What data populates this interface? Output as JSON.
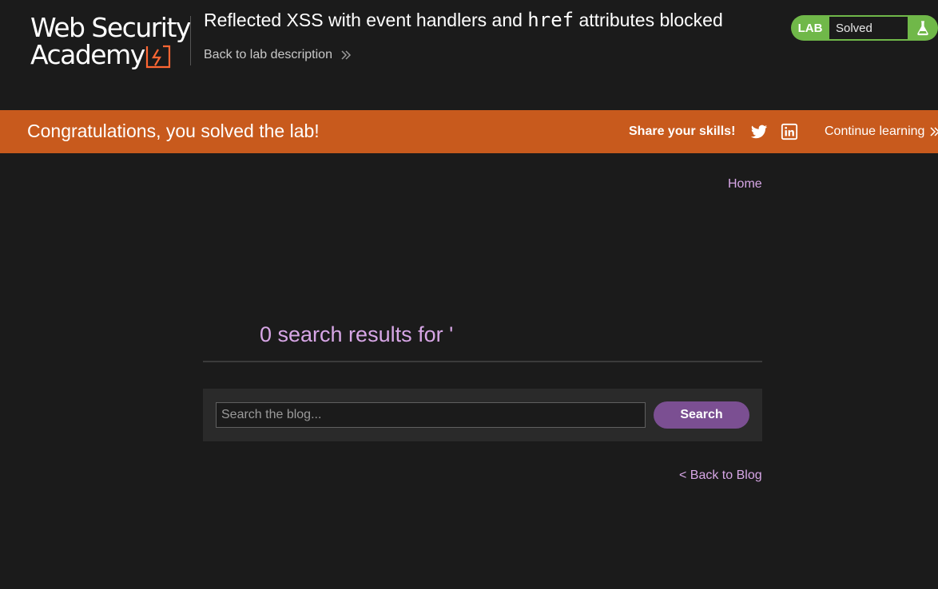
{
  "header": {
    "logo_line1": "Web Security",
    "logo_line2": "Academy",
    "title_before": "Reflected XSS with event handlers and",
    "title_code": "href",
    "title_after": "attributes blocked",
    "back_link": "Back to lab description",
    "lab_label": "LAB",
    "lab_status": "Solved"
  },
  "notification": {
    "congrats": "Congratulations, you solved the lab!",
    "share_label": "Share your skills!",
    "continue_label": "Continue learning"
  },
  "nav": {
    "home": "Home"
  },
  "main": {
    "results_heading": "0 search results for '",
    "search_placeholder": "Search the blog...",
    "search_button": "Search",
    "back_to_blog": "< Back to Blog"
  },
  "colors": {
    "background": "#1b1b1b",
    "notification_bar": "#c85a1d",
    "lab_status_green": "#70b849",
    "link_purple": "#d7a6e6",
    "button_purple": "#7b4f92"
  },
  "icons": {
    "back_chevrons": "double-chevron-right-icon",
    "flask": "flask-icon",
    "twitter": "twitter-icon",
    "linkedin": "linkedin-icon",
    "continue_chevrons": "double-chevron-right-icon"
  }
}
